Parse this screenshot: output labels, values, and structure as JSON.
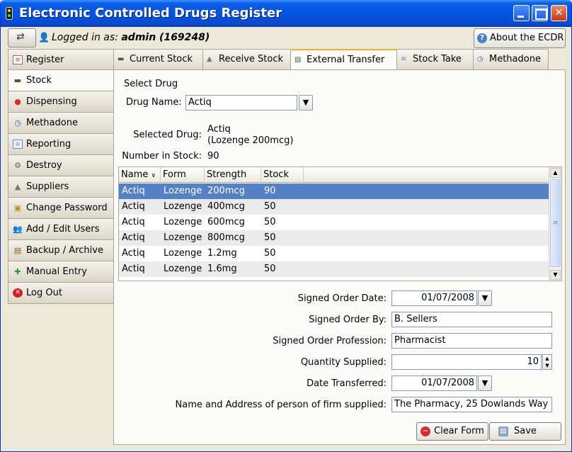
{
  "window": {
    "title": "Electronic Controlled Drugs Register"
  },
  "header": {
    "logged_in_label": "Logged in as:",
    "user": "admin (169248)",
    "about_label": "About the ECDR"
  },
  "sidebar": {
    "items": [
      {
        "label": "Register",
        "icon": "register-icon"
      },
      {
        "label": "Stock",
        "icon": "truck-icon",
        "active": true
      },
      {
        "label": "Dispensing",
        "icon": "pill-icon"
      },
      {
        "label": "Methadone",
        "icon": "clock-icon"
      },
      {
        "label": "Reporting",
        "icon": "report-icon"
      },
      {
        "label": "Destroy",
        "icon": "destroy-icon"
      },
      {
        "label": "Suppliers",
        "icon": "suppliers-icon"
      },
      {
        "label": "Change Password",
        "icon": "key-icon"
      },
      {
        "label": "Add / Edit Users",
        "icon": "users-icon"
      },
      {
        "label": "Backup / Archive",
        "icon": "archive-icon"
      },
      {
        "label": "Manual Entry",
        "icon": "manual-entry-icon"
      },
      {
        "label": "Log Out",
        "icon": "logout-icon"
      }
    ]
  },
  "tabs": [
    {
      "label": "Current Stock",
      "icon": "truck-icon"
    },
    {
      "label": "Receive Stock",
      "icon": "receive-icon"
    },
    {
      "label": "External Transfer",
      "icon": "transfer-icon",
      "active": true
    },
    {
      "label": "Stock Take",
      "icon": "stocktake-icon"
    },
    {
      "label": "Methadone",
      "icon": "clock-icon"
    }
  ],
  "form": {
    "select_drug_heading": "Select Drug",
    "drug_name_label": "Drug Name:",
    "drug_name_value": "Actiq",
    "selected_drug_label": "Selected Drug:",
    "selected_drug_line1": "Actiq",
    "selected_drug_line2": "(Lozenge 200mcg)",
    "number_in_stock_label": "Number in Stock:",
    "number_in_stock_value": "90",
    "signed_order_date_label": "Signed Order Date:",
    "signed_order_date_value": "01/07/2008",
    "signed_order_by_label": "Signed Order By:",
    "signed_order_by_value": "B. Sellers",
    "signed_order_profession_label": "Signed Order Profession:",
    "signed_order_profession_value": "Pharmacist",
    "quantity_supplied_label": "Quantity Supplied:",
    "quantity_supplied_value": "10",
    "date_transferred_label": "Date Transferred:",
    "date_transferred_value": "01/07/2008",
    "supplied_to_label": "Name and Address of person of firm supplied:",
    "supplied_to_value": "The Pharmacy, 25 Dowlands Way"
  },
  "table": {
    "columns": [
      "Name",
      "Form",
      "Strength",
      "Stock"
    ],
    "rows": [
      [
        "Actiq",
        "Lozenge",
        "200mcg",
        "90"
      ],
      [
        "Actiq",
        "Lozenge",
        "400mcg",
        "50"
      ],
      [
        "Actiq",
        "Lozenge",
        "600mcg",
        "50"
      ],
      [
        "Actiq",
        "Lozenge",
        "800mcg",
        "50"
      ],
      [
        "Actiq",
        "Lozenge",
        "1.2mg",
        "50"
      ],
      [
        "Actiq",
        "Lozenge",
        "1.6mg",
        "50"
      ]
    ],
    "selected_row": 0
  },
  "buttons": {
    "clear_form": "Clear Form",
    "save": "Save"
  }
}
